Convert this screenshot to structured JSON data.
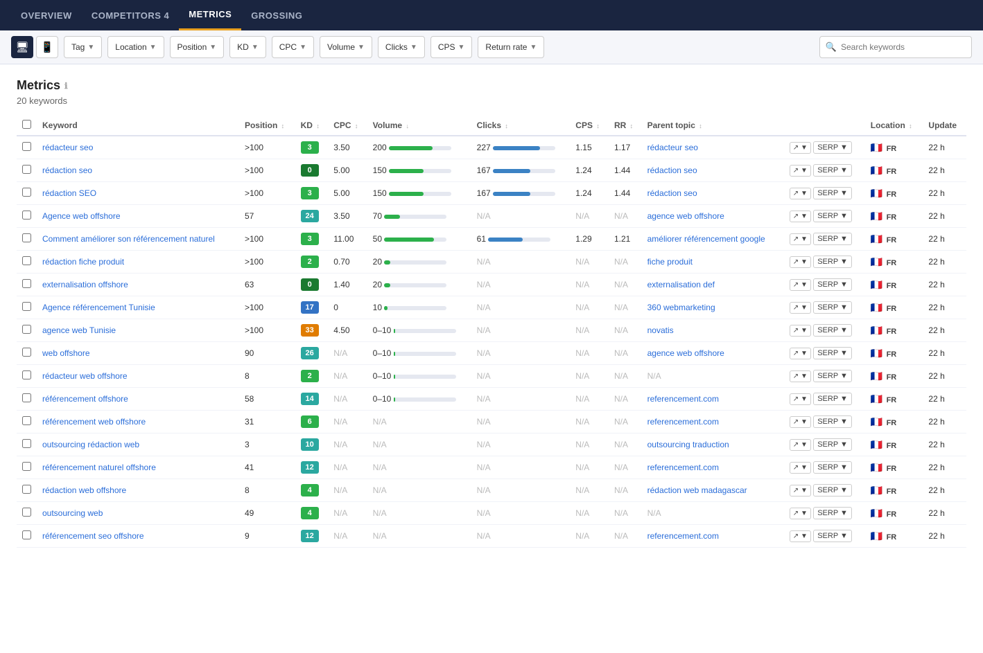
{
  "nav": {
    "items": [
      {
        "id": "overview",
        "label": "OVERVIEW",
        "active": false
      },
      {
        "id": "competitors",
        "label": "COMPETITORS 4",
        "active": false
      },
      {
        "id": "metrics",
        "label": "METRICS",
        "active": true
      },
      {
        "id": "grossing",
        "label": "GROSSING",
        "active": false
      }
    ]
  },
  "filters": {
    "tag_label": "Tag",
    "location_label": "Location",
    "position_label": "Position",
    "kd_label": "KD",
    "cpc_label": "CPC",
    "volume_label": "Volume",
    "clicks_label": "Clicks",
    "cps_label": "CPS",
    "returnrate_label": "Return rate",
    "search_placeholder": "Search keywords"
  },
  "section": {
    "title": "Metrics",
    "keyword_count": "20 keywords"
  },
  "table": {
    "columns": [
      "Keyword",
      "Position",
      "KD",
      "CPC",
      "Volume",
      "Clicks",
      "CPS",
      "RR",
      "Parent topic",
      "",
      "Location",
      "Update"
    ],
    "rows": [
      {
        "keyword": "rédacteur seo",
        "position": ">100",
        "kd": 3,
        "kd_color": "green",
        "cpc": "3.50",
        "volume": "200",
        "volume_bar": 70,
        "volume_bar_color": "green",
        "clicks": "227",
        "clicks_bar": 75,
        "clicks_bar_color": "blue",
        "cps": "1.15",
        "rr": "1.17",
        "parent": "rédacteur seo",
        "update": "22 h"
      },
      {
        "keyword": "rédaction seo",
        "position": ">100",
        "kd": 0,
        "kd_color": "dark-green",
        "cpc": "5.00",
        "volume": "150",
        "volume_bar": 55,
        "volume_bar_color": "green",
        "clicks": "167",
        "clicks_bar": 60,
        "clicks_bar_color": "blue",
        "cps": "1.24",
        "rr": "1.44",
        "parent": "rédaction seo",
        "update": "22 h"
      },
      {
        "keyword": "rédaction SEO",
        "position": ">100",
        "kd": 3,
        "kd_color": "green",
        "cpc": "5.00",
        "volume": "150",
        "volume_bar": 55,
        "volume_bar_color": "green",
        "clicks": "167",
        "clicks_bar": 60,
        "clicks_bar_color": "blue",
        "cps": "1.24",
        "rr": "1.44",
        "parent": "rédaction seo",
        "update": "22 h"
      },
      {
        "keyword": "Agence web offshore",
        "position": "57",
        "kd": 24,
        "kd_color": "teal",
        "cpc": "3.50",
        "volume": "70",
        "volume_bar": 25,
        "volume_bar_color": "green",
        "clicks": "N/A",
        "clicks_bar": 0,
        "clicks_bar_color": "blue",
        "cps": "N/A",
        "rr": "N/A",
        "parent": "agence web offshore",
        "update": "22 h"
      },
      {
        "keyword": "Comment améliorer son référencement naturel",
        "position": ">100",
        "kd": 3,
        "kd_color": "green",
        "cpc": "11.00",
        "volume": "50",
        "volume_bar": 80,
        "volume_bar_color": "green",
        "clicks": "61",
        "clicks_bar": 55,
        "clicks_bar_color": "blue",
        "cps": "1.29",
        "rr": "1.21",
        "parent": "améliorer référencement google",
        "update": "22 h"
      },
      {
        "keyword": "rédaction fiche produit",
        "position": ">100",
        "kd": 2,
        "kd_color": "green",
        "cpc": "0.70",
        "volume": "20",
        "volume_bar": 10,
        "volume_bar_color": "green",
        "clicks": "N/A",
        "clicks_bar": 0,
        "clicks_bar_color": "blue",
        "cps": "N/A",
        "rr": "N/A",
        "parent": "fiche produit",
        "update": "22 h"
      },
      {
        "keyword": "externalisation offshore",
        "position": "63",
        "kd": 0,
        "kd_color": "dark-green",
        "cpc": "1.40",
        "volume": "20",
        "volume_bar": 10,
        "volume_bar_color": "green",
        "clicks": "N/A",
        "clicks_bar": 0,
        "clicks_bar_color": "blue",
        "cps": "N/A",
        "rr": "N/A",
        "parent": "externalisation def",
        "update": "22 h"
      },
      {
        "keyword": "Agence référencement Tunisie",
        "position": ">100",
        "kd": 17,
        "kd_color": "blue",
        "cpc": "0",
        "volume": "10",
        "volume_bar": 5,
        "volume_bar_color": "green",
        "clicks": "N/A",
        "clicks_bar": 0,
        "clicks_bar_color": "blue",
        "cps": "N/A",
        "rr": "N/A",
        "parent": "360 webmarketing",
        "update": "22 h"
      },
      {
        "keyword": "agence web Tunisie",
        "position": ">100",
        "kd": 33,
        "kd_color": "orange",
        "cpc": "4.50",
        "volume": "0–10",
        "volume_bar": 3,
        "volume_bar_color": "green",
        "clicks": "N/A",
        "clicks_bar": 0,
        "clicks_bar_color": "blue",
        "cps": "N/A",
        "rr": "N/A",
        "parent": "novatis",
        "update": "22 h"
      },
      {
        "keyword": "web offshore",
        "position": "90",
        "kd": 26,
        "kd_color": "teal",
        "cpc": "N/A",
        "volume": "0–10",
        "volume_bar": 3,
        "volume_bar_color": "green",
        "clicks": "N/A",
        "clicks_bar": 0,
        "clicks_bar_color": "blue",
        "cps": "N/A",
        "rr": "N/A",
        "parent": "agence web offshore",
        "update": "22 h"
      },
      {
        "keyword": "rédacteur web offshore",
        "position": "8",
        "kd": 2,
        "kd_color": "green",
        "cpc": "N/A",
        "volume": "0–10",
        "volume_bar": 3,
        "volume_bar_color": "green",
        "clicks": "N/A",
        "clicks_bar": 0,
        "clicks_bar_color": "blue",
        "cps": "N/A",
        "rr": "N/A",
        "parent": "N/A",
        "update": "22 h"
      },
      {
        "keyword": "référencement offshore",
        "position": "58",
        "kd": 14,
        "kd_color": "teal",
        "cpc": "N/A",
        "volume": "0–10",
        "volume_bar": 3,
        "volume_bar_color": "green",
        "clicks": "N/A",
        "clicks_bar": 0,
        "clicks_bar_color": "blue",
        "cps": "N/A",
        "rr": "N/A",
        "parent": "referencement.com",
        "update": "22 h"
      },
      {
        "keyword": "référencement web offshore",
        "position": "31",
        "kd": 6,
        "kd_color": "green",
        "cpc": "N/A",
        "volume": "N/A",
        "volume_bar": 0,
        "volume_bar_color": "green",
        "clicks": "N/A",
        "clicks_bar": 0,
        "clicks_bar_color": "blue",
        "cps": "N/A",
        "rr": "N/A",
        "parent": "referencement.com",
        "update": "22 h"
      },
      {
        "keyword": "outsourcing rédaction web",
        "position": "3",
        "kd": 10,
        "kd_color": "teal",
        "cpc": "N/A",
        "volume": "N/A",
        "volume_bar": 0,
        "volume_bar_color": "green",
        "clicks": "N/A",
        "clicks_bar": 0,
        "clicks_bar_color": "blue",
        "cps": "N/A",
        "rr": "N/A",
        "parent": "outsourcing traduction",
        "update": "22 h"
      },
      {
        "keyword": "référencement naturel offshore",
        "position": "41",
        "kd": 12,
        "kd_color": "teal",
        "cpc": "N/A",
        "volume": "N/A",
        "volume_bar": 0,
        "volume_bar_color": "green",
        "clicks": "N/A",
        "clicks_bar": 0,
        "clicks_bar_color": "blue",
        "cps": "N/A",
        "rr": "N/A",
        "parent": "referencement.com",
        "update": "22 h"
      },
      {
        "keyword": "rédaction web offshore",
        "position": "8",
        "kd": 4,
        "kd_color": "green",
        "cpc": "N/A",
        "volume": "N/A",
        "volume_bar": 0,
        "volume_bar_color": "green",
        "clicks": "N/A",
        "clicks_bar": 0,
        "clicks_bar_color": "blue",
        "cps": "N/A",
        "rr": "N/A",
        "parent": "rédaction web madagascar",
        "update": "22 h"
      },
      {
        "keyword": "outsourcing web",
        "position": "49",
        "kd": 4,
        "kd_color": "green",
        "cpc": "N/A",
        "volume": "N/A",
        "volume_bar": 0,
        "volume_bar_color": "green",
        "clicks": "N/A",
        "clicks_bar": 0,
        "clicks_bar_color": "blue",
        "cps": "N/A",
        "rr": "N/A",
        "parent": "N/A",
        "update": "22 h"
      },
      {
        "keyword": "référencement seo offshore",
        "position": "9",
        "kd": 12,
        "kd_color": "teal",
        "cpc": "N/A",
        "volume": "N/A",
        "volume_bar": 0,
        "volume_bar_color": "green",
        "clicks": "N/A",
        "clicks_bar": 0,
        "clicks_bar_color": "blue",
        "cps": "N/A",
        "rr": "N/A",
        "parent": "referencement.com",
        "update": "22 h"
      }
    ]
  }
}
